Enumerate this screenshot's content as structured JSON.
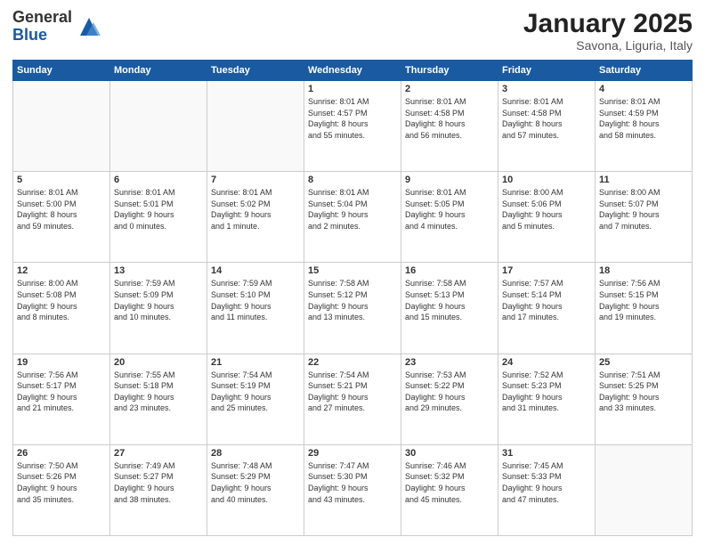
{
  "header": {
    "logo_general": "General",
    "logo_blue": "Blue",
    "month_title": "January 2025",
    "subtitle": "Savona, Liguria, Italy"
  },
  "days_of_week": [
    "Sunday",
    "Monday",
    "Tuesday",
    "Wednesday",
    "Thursday",
    "Friday",
    "Saturday"
  ],
  "weeks": [
    [
      {
        "day": "",
        "info": ""
      },
      {
        "day": "",
        "info": ""
      },
      {
        "day": "",
        "info": ""
      },
      {
        "day": "1",
        "info": "Sunrise: 8:01 AM\nSunset: 4:57 PM\nDaylight: 8 hours\nand 55 minutes."
      },
      {
        "day": "2",
        "info": "Sunrise: 8:01 AM\nSunset: 4:58 PM\nDaylight: 8 hours\nand 56 minutes."
      },
      {
        "day": "3",
        "info": "Sunrise: 8:01 AM\nSunset: 4:58 PM\nDaylight: 8 hours\nand 57 minutes."
      },
      {
        "day": "4",
        "info": "Sunrise: 8:01 AM\nSunset: 4:59 PM\nDaylight: 8 hours\nand 58 minutes."
      }
    ],
    [
      {
        "day": "5",
        "info": "Sunrise: 8:01 AM\nSunset: 5:00 PM\nDaylight: 8 hours\nand 59 minutes."
      },
      {
        "day": "6",
        "info": "Sunrise: 8:01 AM\nSunset: 5:01 PM\nDaylight: 9 hours\nand 0 minutes."
      },
      {
        "day": "7",
        "info": "Sunrise: 8:01 AM\nSunset: 5:02 PM\nDaylight: 9 hours\nand 1 minute."
      },
      {
        "day": "8",
        "info": "Sunrise: 8:01 AM\nSunset: 5:04 PM\nDaylight: 9 hours\nand 2 minutes."
      },
      {
        "day": "9",
        "info": "Sunrise: 8:01 AM\nSunset: 5:05 PM\nDaylight: 9 hours\nand 4 minutes."
      },
      {
        "day": "10",
        "info": "Sunrise: 8:00 AM\nSunset: 5:06 PM\nDaylight: 9 hours\nand 5 minutes."
      },
      {
        "day": "11",
        "info": "Sunrise: 8:00 AM\nSunset: 5:07 PM\nDaylight: 9 hours\nand 7 minutes."
      }
    ],
    [
      {
        "day": "12",
        "info": "Sunrise: 8:00 AM\nSunset: 5:08 PM\nDaylight: 9 hours\nand 8 minutes."
      },
      {
        "day": "13",
        "info": "Sunrise: 7:59 AM\nSunset: 5:09 PM\nDaylight: 9 hours\nand 10 minutes."
      },
      {
        "day": "14",
        "info": "Sunrise: 7:59 AM\nSunset: 5:10 PM\nDaylight: 9 hours\nand 11 minutes."
      },
      {
        "day": "15",
        "info": "Sunrise: 7:58 AM\nSunset: 5:12 PM\nDaylight: 9 hours\nand 13 minutes."
      },
      {
        "day": "16",
        "info": "Sunrise: 7:58 AM\nSunset: 5:13 PM\nDaylight: 9 hours\nand 15 minutes."
      },
      {
        "day": "17",
        "info": "Sunrise: 7:57 AM\nSunset: 5:14 PM\nDaylight: 9 hours\nand 17 minutes."
      },
      {
        "day": "18",
        "info": "Sunrise: 7:56 AM\nSunset: 5:15 PM\nDaylight: 9 hours\nand 19 minutes."
      }
    ],
    [
      {
        "day": "19",
        "info": "Sunrise: 7:56 AM\nSunset: 5:17 PM\nDaylight: 9 hours\nand 21 minutes."
      },
      {
        "day": "20",
        "info": "Sunrise: 7:55 AM\nSunset: 5:18 PM\nDaylight: 9 hours\nand 23 minutes."
      },
      {
        "day": "21",
        "info": "Sunrise: 7:54 AM\nSunset: 5:19 PM\nDaylight: 9 hours\nand 25 minutes."
      },
      {
        "day": "22",
        "info": "Sunrise: 7:54 AM\nSunset: 5:21 PM\nDaylight: 9 hours\nand 27 minutes."
      },
      {
        "day": "23",
        "info": "Sunrise: 7:53 AM\nSunset: 5:22 PM\nDaylight: 9 hours\nand 29 minutes."
      },
      {
        "day": "24",
        "info": "Sunrise: 7:52 AM\nSunset: 5:23 PM\nDaylight: 9 hours\nand 31 minutes."
      },
      {
        "day": "25",
        "info": "Sunrise: 7:51 AM\nSunset: 5:25 PM\nDaylight: 9 hours\nand 33 minutes."
      }
    ],
    [
      {
        "day": "26",
        "info": "Sunrise: 7:50 AM\nSunset: 5:26 PM\nDaylight: 9 hours\nand 35 minutes."
      },
      {
        "day": "27",
        "info": "Sunrise: 7:49 AM\nSunset: 5:27 PM\nDaylight: 9 hours\nand 38 minutes."
      },
      {
        "day": "28",
        "info": "Sunrise: 7:48 AM\nSunset: 5:29 PM\nDaylight: 9 hours\nand 40 minutes."
      },
      {
        "day": "29",
        "info": "Sunrise: 7:47 AM\nSunset: 5:30 PM\nDaylight: 9 hours\nand 43 minutes."
      },
      {
        "day": "30",
        "info": "Sunrise: 7:46 AM\nSunset: 5:32 PM\nDaylight: 9 hours\nand 45 minutes."
      },
      {
        "day": "31",
        "info": "Sunrise: 7:45 AM\nSunset: 5:33 PM\nDaylight: 9 hours\nand 47 minutes."
      },
      {
        "day": "",
        "info": ""
      }
    ]
  ]
}
